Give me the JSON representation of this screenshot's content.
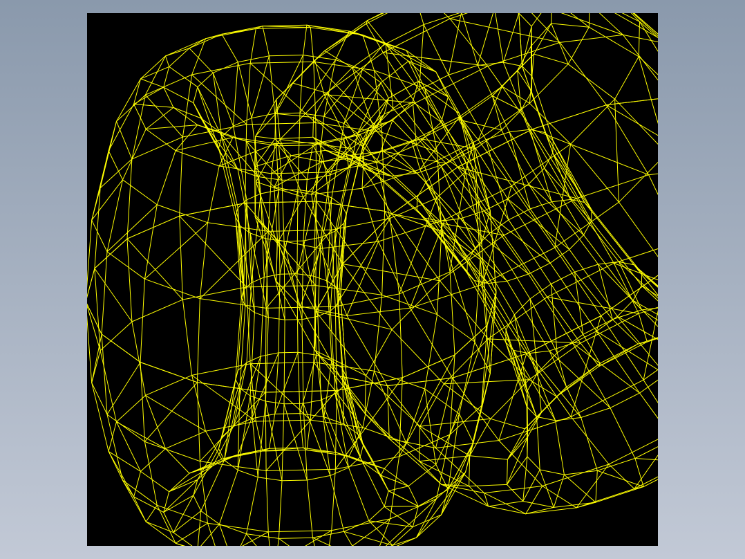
{
  "viewport": {
    "background_color": "#000000",
    "wire_color": "#ffff00",
    "render_mode": "wireframe"
  },
  "page": {
    "background_top_color": "#8a99ac",
    "background_bottom_color": "#c2c9d6"
  },
  "objects": [
    {
      "name": "front-torus-part",
      "kind": "wireframe-shell"
    },
    {
      "name": "back-torus-part",
      "kind": "wireframe-shell"
    }
  ]
}
